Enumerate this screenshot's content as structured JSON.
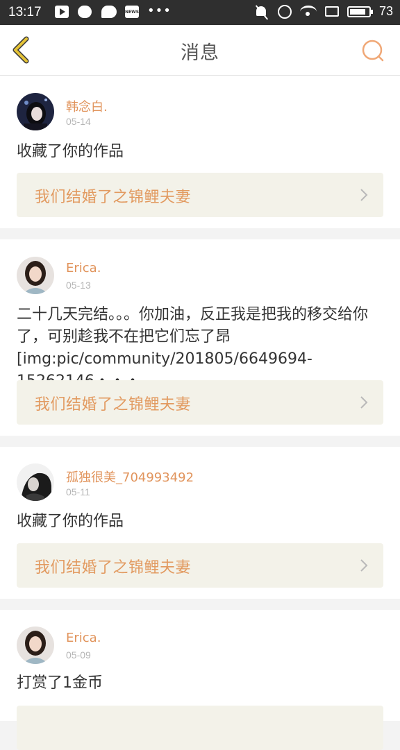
{
  "status_bar": {
    "time": "13:17",
    "news_label": "NEWS",
    "more": "•••",
    "battery": "73"
  },
  "header": {
    "title": "消息"
  },
  "colors": {
    "accent": "#e29a60",
    "back_chevron": "#e5c337",
    "link_bg": "#f3f2e9"
  },
  "messages": [
    {
      "user": "韩念白.",
      "date": "05-14",
      "text": "收藏了你的作品",
      "work": "我们结婚了之锦鲤夫妻"
    },
    {
      "user": "Erica.",
      "date": "05-13",
      "text": "二十几天完结。。。你加油，反正我是把我的移交给你了，可别趁我不在把它们忘了昂[img:pic/community/201805/6649694-15262146・・・",
      "work": "我们结婚了之锦鲤夫妻"
    },
    {
      "user": "孤独很美_704993492",
      "date": "05-11",
      "text": "收藏了你的作品",
      "work": "我们结婚了之锦鲤夫妻"
    },
    {
      "user": "Erica.",
      "date": "05-09",
      "text": "打赏了1金币",
      "work": ""
    }
  ]
}
